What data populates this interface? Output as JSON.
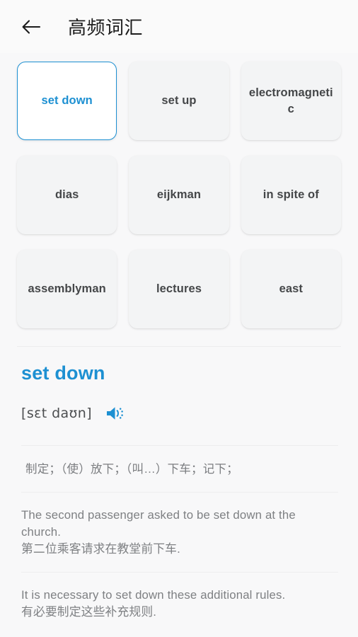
{
  "header": {
    "back_icon": "arrow-left-icon",
    "title": "高频词汇"
  },
  "word_grid": {
    "selected_index": 0,
    "cards": [
      {
        "label": "set down"
      },
      {
        "label": "set up"
      },
      {
        "label": "electromagnetic"
      },
      {
        "label": "dias"
      },
      {
        "label": "eijkman"
      },
      {
        "label": "in spite of"
      },
      {
        "label": "assemblyman"
      },
      {
        "label": "lectures"
      },
      {
        "label": "east"
      }
    ]
  },
  "detail": {
    "word": "set down",
    "phonetic": "[sɛt daʊn]",
    "speaker_icon": "speaker-icon",
    "definition": "制定；（使）放下；（叫…）下车；记下；",
    "examples": [
      {
        "en": "The second passenger asked to be set down at the church.",
        "zh": "第二位乘客请求在教堂前下车."
      },
      {
        "en": "It is necessary to set down these additional rules.",
        "zh": "有必要制定这些补充规则."
      }
    ]
  },
  "colors": {
    "accent": "#1d90d2",
    "page_bg": "#f8f8f9",
    "card_bg": "#f3f4f5",
    "text_primary": "#1c1c1c",
    "text_secondary": "#7e8083"
  }
}
